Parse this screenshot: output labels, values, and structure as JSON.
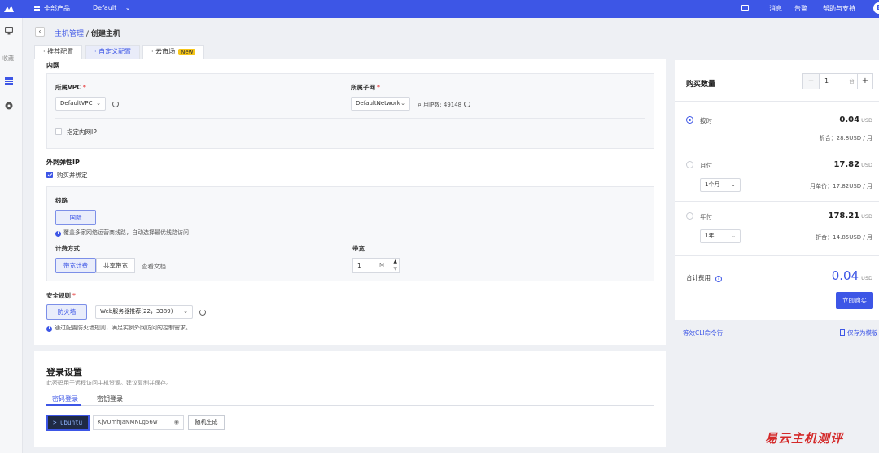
{
  "topbar": {
    "all_products": "全部产品",
    "project": "Default",
    "project_chevron": "⌄",
    "nav": [
      "消息",
      "告警",
      "帮助与支持"
    ],
    "avatar": "E",
    "brand_color": "#3d56e6"
  },
  "leftnav": {
    "favorites": "收藏",
    "icons": [
      "monitor-icon",
      "list-icon",
      "gauge-icon"
    ]
  },
  "breadcrumb": {
    "back": "‹",
    "parent": "主机管理",
    "separator": "/",
    "current": "创建主机"
  },
  "tabs": [
    {
      "label": "推荐配置",
      "active": false
    },
    {
      "label": "自定义配置",
      "active": true
    },
    {
      "label": "云市场",
      "badge": "New",
      "active": false
    }
  ],
  "intranet": {
    "title": "内网",
    "vpc_label": "所属VPC",
    "vpc_value": "DefaultVPC",
    "subnet_label": "所属子网",
    "subnet_value": "DefaultNetwork",
    "available_ip": "可用IP数: 49148",
    "specify_ip": "指定内网IP",
    "required_mark": "*"
  },
  "eip": {
    "title": "外网弹性IP",
    "bind_label": "购买并绑定",
    "line_label": "线路",
    "line_value": "国际",
    "line_hint": "覆盖多家网络运营商线路，自动选择最优线路访问",
    "billing_label": "计费方式",
    "billing_options": [
      "带宽计费",
      "共享带宽"
    ],
    "view_docs": "查看文档",
    "bandwidth_label": "带宽",
    "bandwidth_value": "1",
    "bandwidth_unit": "M"
  },
  "security": {
    "title": "安全规则",
    "firewall": "防火墙",
    "rule_value": "Web服务器推荐(22，3389)",
    "hint": "通过配置防火墙规则，满足实例外网访问的控制需求。"
  },
  "login": {
    "title": "登录设置",
    "subtitle": "此密码用于远程访问主机资源。建议复制并保存。",
    "tabs": [
      "密码登录",
      "密钥登录"
    ],
    "username": "> ubuntu",
    "password": "KjVUmhJaNMNLg56w",
    "generate": "随机生成"
  },
  "purchase": {
    "qty_label": "购买数量",
    "qty_value": "1",
    "qty_unit": "台",
    "minus": "−",
    "plus": "+",
    "options": [
      {
        "name": "按时",
        "price": "0.04",
        "currency": "USD",
        "sub": "折合：28.8USD / 月",
        "selected": true
      },
      {
        "name": "月付",
        "price": "17.82",
        "currency": "USD",
        "select": "1个月",
        "sub": "月单价：17.82USD / 月",
        "selected": false
      },
      {
        "name": "年付",
        "price": "178.21",
        "currency": "USD",
        "select": "1年",
        "sub": "折合：14.85USD / 月",
        "selected": false
      }
    ],
    "total_label": "合计费用",
    "total_value": "0.04",
    "total_currency": "USD",
    "buy": "立即购买",
    "cli_link": "等效CLI命令行",
    "save_template": "保存为模版"
  },
  "watermark": "易云主机测评"
}
